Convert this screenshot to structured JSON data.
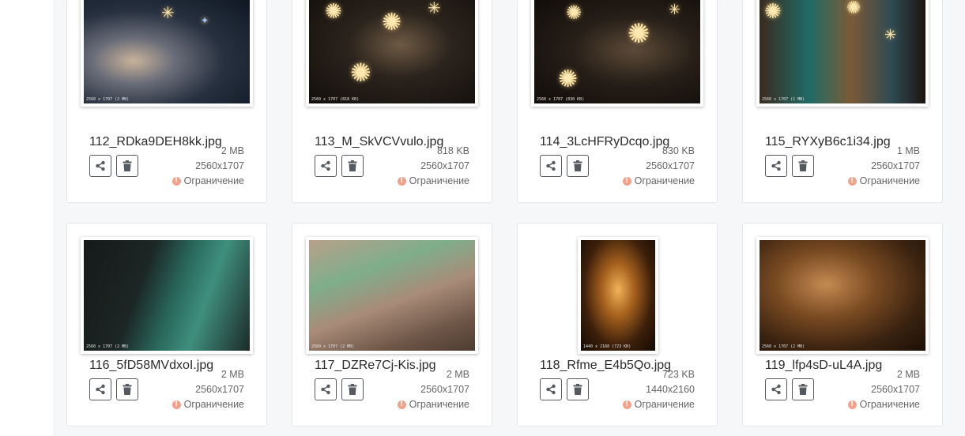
{
  "restriction_label": "Ограничение",
  "images": [
    {
      "name": "112_RDka9DEH8kk.jpg",
      "size": "2 MB",
      "dims": "2560x1707",
      "caption": "2560 x 1707 (2 MB)"
    },
    {
      "name": "113_M_SkVCVvulo.jpg",
      "size": "818 KB",
      "dims": "2560x1707",
      "caption": "2560 x 1707 (818 KB)"
    },
    {
      "name": "114_3LcHFRyDcqo.jpg",
      "size": "830 KB",
      "dims": "2560x1707",
      "caption": "2560 x 1707 (830 KB)"
    },
    {
      "name": "115_RYXyB6c1i34.jpg",
      "size": "1 MB",
      "dims": "2560x1707",
      "caption": "2560 x 1707 (1 MB)"
    },
    {
      "name": "116_5fD58MVdxoI.jpg",
      "size": "2 MB",
      "dims": "2560x1707",
      "caption": "2560 x 1707 (2 MB)"
    },
    {
      "name": "117_DZRe7Cj-Kis.jpg",
      "size": "2 MB",
      "dims": "2560x1707",
      "caption": "2560 x 1707 (2 MB)"
    },
    {
      "name": "118_Rfme_E4b5Qo.jpg",
      "size": "723 KB",
      "dims": "1440x2160",
      "caption": "1440 x 2160 (723 KB)"
    },
    {
      "name": "119_lfp4sD-uL4A.jpg",
      "size": "2 MB",
      "dims": "2560x1707",
      "caption": "2560 x 1707 (2 MB)"
    }
  ],
  "colors": {
    "warning": "#f2a18a",
    "button_border": "#555a60",
    "background": "#f6f7f9"
  },
  "icons": {
    "share": "share-icon",
    "delete": "trash-icon",
    "warning": "exclamation-circle-icon"
  }
}
